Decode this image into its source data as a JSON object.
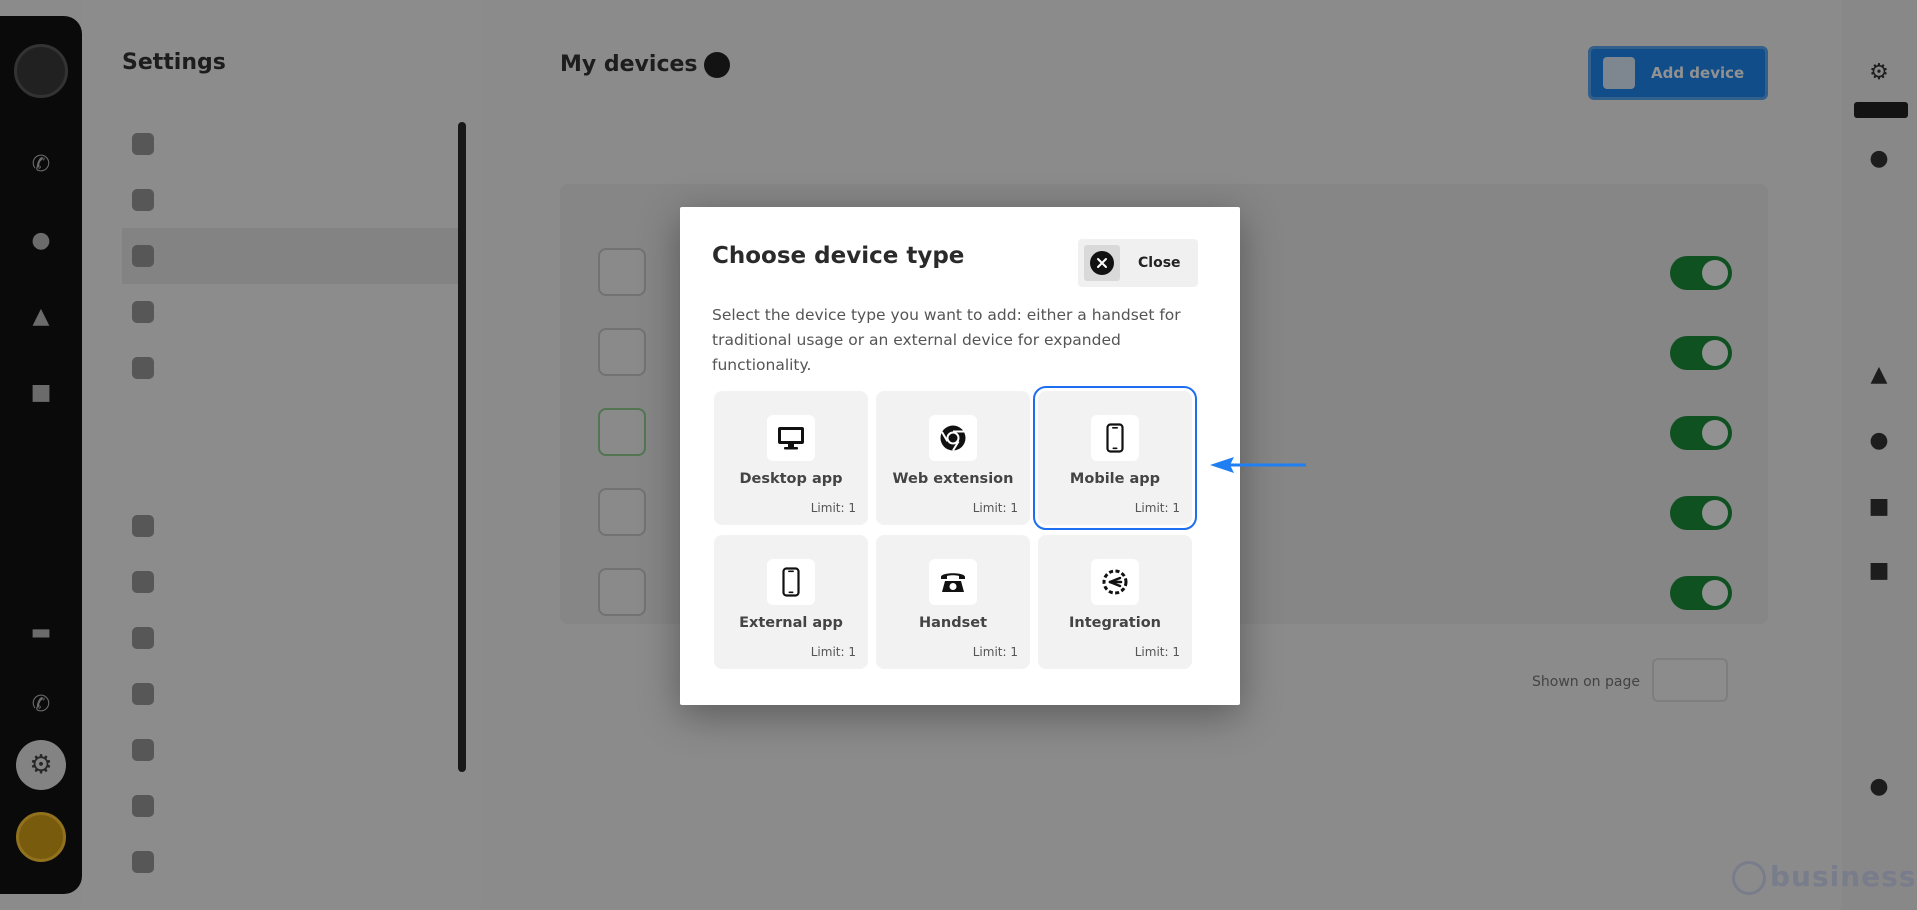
{
  "background": {
    "settings_title": "Settings",
    "page_title": "My devices",
    "add_button": "Add device",
    "pager_label": "Shown on page"
  },
  "modal": {
    "title": "Choose device type",
    "close_label": "Close",
    "description": "Select the device type you want to add: either a handset for traditional usage or an external device for expanded functionality.",
    "cards": [
      {
        "label": "Desktop app",
        "limit": "Limit: 1",
        "icon": "desktop-icon"
      },
      {
        "label": "Web extension",
        "limit": "Limit: 1",
        "icon": "chrome-icon"
      },
      {
        "label": "Mobile app",
        "limit": "Limit: 1",
        "icon": "mobile-phone-icon",
        "selected": true
      },
      {
        "label": "External app",
        "limit": "Limit: 1",
        "icon": "smartphone-icon"
      },
      {
        "label": "Handset",
        "limit": "Limit: 1",
        "icon": "telephone-icon"
      },
      {
        "label": "Integration",
        "limit": "Limit: 1",
        "icon": "integration-icon"
      }
    ]
  },
  "colors": {
    "accent": "#1d6ef0",
    "arrow": "#1f7ef2",
    "toggle_on": "#1d8f3a"
  }
}
